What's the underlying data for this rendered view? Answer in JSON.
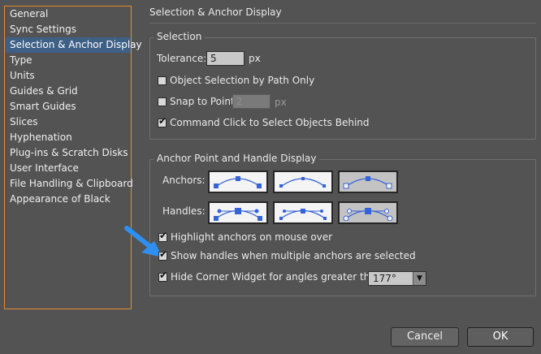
{
  "sidebar": {
    "items": [
      {
        "label": "General"
      },
      {
        "label": "Sync Settings"
      },
      {
        "label": "Selection & Anchor Display",
        "selected": true
      },
      {
        "label": "Type"
      },
      {
        "label": "Units"
      },
      {
        "label": "Guides & Grid"
      },
      {
        "label": "Smart Guides"
      },
      {
        "label": "Slices"
      },
      {
        "label": "Hyphenation"
      },
      {
        "label": "Plug-ins & Scratch Disks"
      },
      {
        "label": "User Interface"
      },
      {
        "label": "File Handling & Clipboard"
      },
      {
        "label": "Appearance of Black"
      }
    ]
  },
  "section_title": "Selection & Anchor Display",
  "selection_group": {
    "legend": "Selection",
    "tolerance_label": "Tolerance:",
    "tolerance_value": "5",
    "tolerance_unit": "px",
    "object_selection_label": "Object Selection by Path Only",
    "object_selection_checked": false,
    "snap_label": "Snap to Point",
    "snap_checked": false,
    "snap_value": "2",
    "snap_unit": "px",
    "command_click_label": "Command Click to Select Objects Behind",
    "command_click_checked": true
  },
  "anchor_group": {
    "legend": "Anchor Point and Handle Display",
    "anchors_label": "Anchors:",
    "handles_label": "Handles:",
    "anchors_selected_index": 2,
    "handles_selected_index": 2,
    "highlight_label": "Highlight anchors on mouse over",
    "highlight_checked": true,
    "show_handles_label": "Show handles when multiple anchors are selected",
    "show_handles_checked": true,
    "hide_corner_label": "Hide Corner Widget for angles greater than:",
    "hide_corner_checked": true,
    "angle_value": "177°"
  },
  "buttons": {
    "cancel": "Cancel",
    "ok": "OK"
  },
  "colors": {
    "background": "#535353",
    "sidebar_border": "#e58a2c",
    "selected_item": "#3e5f86",
    "arrow": "#2f8ff0",
    "widget_blue": "#3563d8"
  },
  "icons": [
    "pointer-arrow-icon",
    "chevron-down-icon",
    "check-icon"
  ]
}
